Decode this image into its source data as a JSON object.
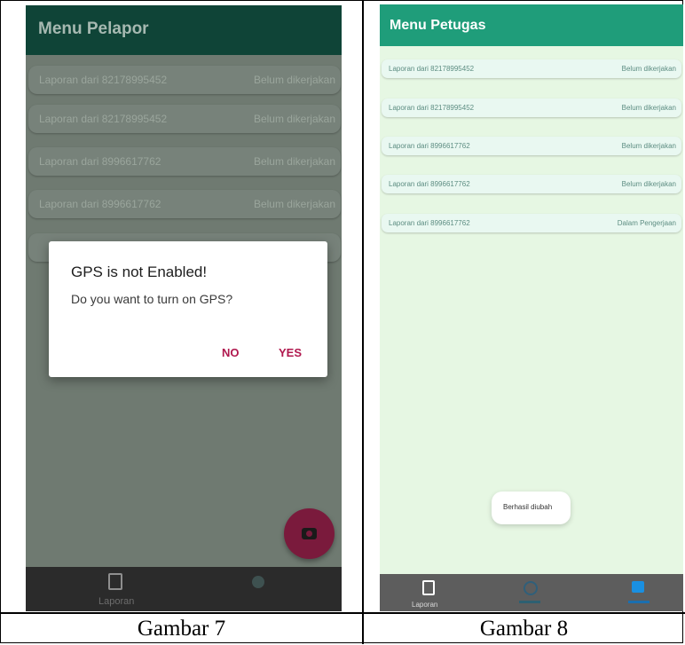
{
  "screens": [
    {
      "header_title": "Menu Pelapor",
      "list_items": [
        {
          "label": "Laporan dari 82178995452",
          "status": "Belum dikerjakan"
        },
        {
          "label": "Laporan dari 82178995452",
          "status": "Belum dikerjakan"
        },
        {
          "label": "Laporan dari 8996617762",
          "status": "Belum dikerjakan"
        },
        {
          "label": "Laporan dari 8996617762",
          "status": "Belum dikerjakan"
        }
      ],
      "dialog": {
        "title": "GPS is not Enabled!",
        "message": "Do you want to turn on GPS?",
        "no_label": "NO",
        "yes_label": "YES"
      },
      "fab_icon": "camera-icon",
      "bottom_nav": [
        {
          "label": "Laporan",
          "icon": "clipboard-icon"
        }
      ]
    },
    {
      "header_title": "Menu Petugas",
      "list_items": [
        {
          "label": "Laporan dari 82178995452",
          "status": "Belum dikerjakan"
        },
        {
          "label": "Laporan dari 82178995452",
          "status": "Belum dikerjakan"
        },
        {
          "label": "Laporan dari 8996617762",
          "status": "Belum dikerjakan"
        },
        {
          "label": "Laporan dari 8996617762",
          "status": "Belum dikerjakan"
        },
        {
          "label": "Laporan dari 8996617762",
          "status": "Dalam Pengerjaan"
        }
      ],
      "toast": "Berhasil diubah",
      "bottom_nav": [
        {
          "label": "Laporan",
          "icon": "clipboard-icon"
        }
      ]
    }
  ],
  "captions": [
    "Gambar 7",
    "Gambar 8"
  ],
  "colors": {
    "header_dark": "#0f4437",
    "header_green": "#1f9d7a",
    "accent_pink": "#b0184e",
    "fab": "#7a1a3c"
  }
}
